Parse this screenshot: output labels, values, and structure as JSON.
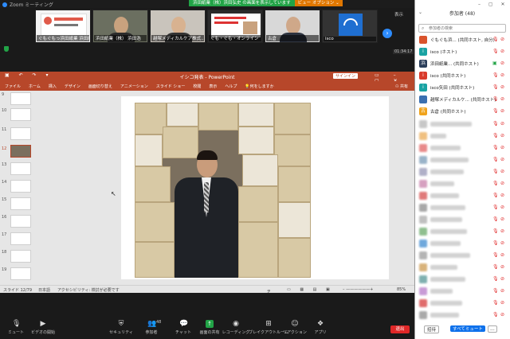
{
  "window": {
    "title": "Zoom ミーティング"
  },
  "share_banner": {
    "text": "浜田紙業（株）浜田弘史 の画面を表示しています",
    "view_option": "ビュー オプション ⌄"
  },
  "thumbnails": [
    {
      "name": "ぐもぐもっ浜田紙業 浜田紙..."
    },
    {
      "name": "浜田紙業（株） 浜田浩"
    },
    {
      "name": "越塚メディカルケア株式..."
    },
    {
      "name": "ぐも・ぐも・オンライン"
    },
    {
      "name": "古倉"
    },
    {
      "name": "isco"
    }
  ],
  "view_button": "表示",
  "timer": "01:34:17",
  "ppt": {
    "title": "イシコ発表 - PowerPoint",
    "signin": "サインイン",
    "menu": [
      "ファイル",
      "ホーム",
      "挿入",
      "デザイン",
      "画面切り替え",
      "アニメーション",
      "スライド ショー",
      "校閲",
      "表示",
      "ヘルプ",
      "何をしますか"
    ],
    "share": "共有",
    "slide_numbers": [
      "9",
      "10",
      "11",
      "12",
      "13",
      "14",
      "15",
      "16",
      "17",
      "18",
      "19"
    ],
    "selected_slide": "12",
    "status": {
      "slide": "スライド 12/79",
      "lang": "日本語",
      "accessibility": "アクセシビリティ: 検討が必要です",
      "notes": "ノート",
      "zoom": "85%"
    }
  },
  "toolbar": {
    "items": [
      {
        "label": "ミュート",
        "icon": "microphone-icon"
      },
      {
        "label": "ビデオの開始",
        "icon": "video-camera-icon"
      },
      {
        "label": "セキュリティ",
        "icon": "shield-icon"
      },
      {
        "label": "参加者",
        "icon": "participants-icon",
        "count": "48"
      },
      {
        "label": "チャット",
        "icon": "chat-icon"
      },
      {
        "label": "画面の共有",
        "icon": "share-screen-icon"
      },
      {
        "label": "レコーディング",
        "icon": "record-icon"
      },
      {
        "label": "ブレイクアウトルーム",
        "icon": "breakout-icon"
      },
      {
        "label": "リアクション",
        "icon": "reaction-icon"
      },
      {
        "label": "アプリ",
        "icon": "apps-icon"
      }
    ],
    "end": "退出"
  },
  "panel": {
    "title": "参加者 (48)",
    "search_placeholder": "参加者の検索",
    "participants": [
      {
        "name": "ぐもぐも浜... (共同ホスト, 自分)",
        "avatar": "",
        "color": "#d9532c"
      },
      {
        "name": "isco (ホスト)",
        "avatar": "i",
        "color": "#19a3a3"
      },
      {
        "name": "浜田紙業... (共同ホスト)",
        "avatar": "浜",
        "color": "#2a3e5a"
      },
      {
        "name": "isco (共同ホスト)",
        "avatar": "i",
        "color": "#d93a2b"
      },
      {
        "name": "isco矢田 (共同ホスト)",
        "avatar": "i",
        "color": "#19a3a3"
      },
      {
        "name": "越塚メディカルケ... (共同ホスト)",
        "avatar": "",
        "color": "#3a6fb0"
      },
      {
        "name": "古倉 (共同ホスト)",
        "avatar": "古",
        "color": "#f0a31c"
      }
    ],
    "invite": "招待",
    "mute_all": "すべてミュート",
    "more": "..."
  }
}
